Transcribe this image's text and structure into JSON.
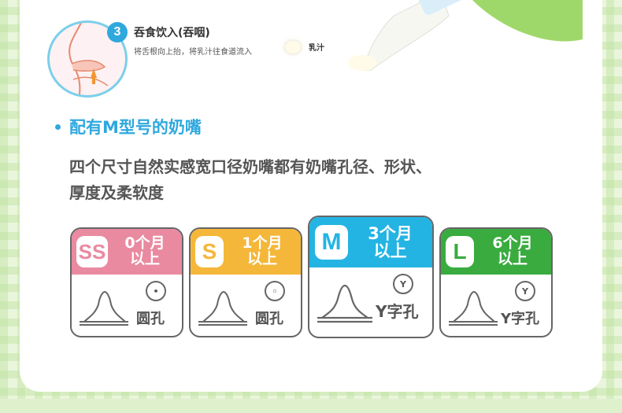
{
  "step": {
    "number": "3",
    "title": "吞食饮入(吞咽)",
    "description": "将舌根向上抬，将乳汁往食道流入",
    "milk_label": "乳汁"
  },
  "section": {
    "title": "配有M型号的奶嘴",
    "description_line1": "四个尺寸自然实感宽口径奶嘴都有奶嘴孔径、形状、",
    "description_line2": "厚度及柔软度"
  },
  "sizes": [
    {
      "letter": "SS",
      "age_line1": "0个月",
      "age_line2": "以上",
      "hole_symbol": "•",
      "hole_label": "圆孔",
      "color": "#e98aa0"
    },
    {
      "letter": "S",
      "age_line1": "1个月",
      "age_line2": "以上",
      "hole_symbol": "◦",
      "hole_label": "圆孔",
      "color": "#f5b73a"
    },
    {
      "letter": "M",
      "age_line1": "3个月",
      "age_line2": "以上",
      "hole_symbol": "Y",
      "hole_label": "Y字孔",
      "color": "#23b4e3"
    },
    {
      "letter": "L",
      "age_line1": "6个月",
      "age_line2": "以上",
      "hole_symbol": "Y",
      "hole_label": "Y字孔",
      "color": "#39ab3f"
    }
  ],
  "colors": {
    "accent": "#2fa8de",
    "background": "#eaf6dc",
    "outline": "#666666"
  }
}
